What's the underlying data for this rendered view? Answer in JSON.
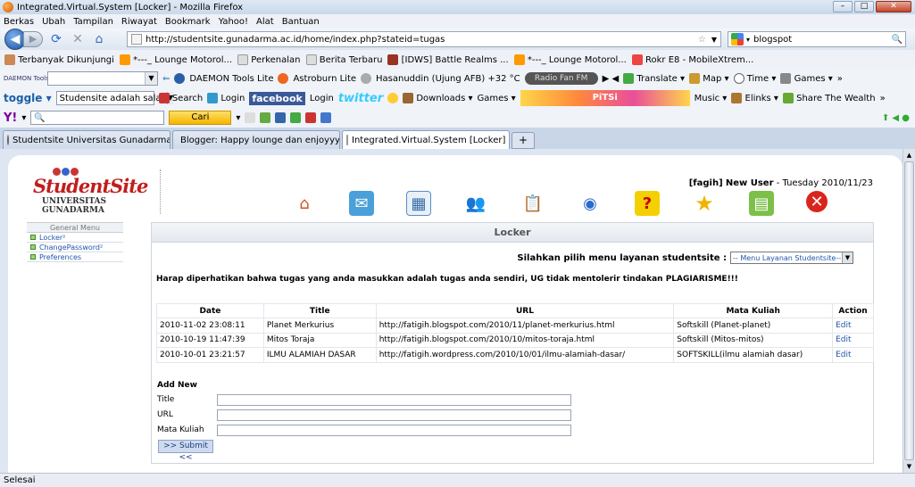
{
  "window": {
    "title": "Integrated.Virtual.System [Locker] - Mozilla Firefox"
  },
  "menubar": [
    "Berkas",
    "Ubah",
    "Tampilan",
    "Riwayat",
    "Bookmark",
    "Yahoo!",
    "Alat",
    "Bantuan"
  ],
  "nav": {
    "url": "http://studentsite.gunadarma.ac.id/home/index.php?stateid=tugas",
    "search_value": "blogspot"
  },
  "bookmarks": [
    "Terbanyak Dikunjungi",
    "*---_ Lounge Motorol...",
    "Perkenalan",
    "Berita Terbaru",
    "[IDWS] Battle Realms ...",
    "*---_ Lounge Motorol...",
    "Rokr E8 - MobileXtrem..."
  ],
  "toolbar1": {
    "daemon_label": "DAEMON Tools Lite",
    "astroburn": "Astroburn Lite",
    "weather": "Hasanuddin (Ujung AFB) +32 °C",
    "radio": "Radio Fan FM",
    "translate": "Translate",
    "map": "Map",
    "time": "Time",
    "games": "Games"
  },
  "toolbar2": {
    "toggle": "toggle",
    "combo_value": "Studensite adalah salah",
    "search": "Search",
    "login1": "Login",
    "facebook": "facebook",
    "login2": "Login",
    "twitter": "twitter",
    "downloads": "Downloads",
    "games": "Games",
    "pitsi": "PiTSi",
    "music": "Music",
    "elinks": "Elinks",
    "share": "Share The Wealth"
  },
  "toolbar3": {
    "yahoo": "Y!",
    "cari": "Cari"
  },
  "tabs": [
    {
      "label": "Studentsite Universitas Gunadarma ..."
    },
    {
      "label": "Blogger: Happy lounge dan enjoyyyy..."
    },
    {
      "label": "Integrated.Virtual.System [Locker]"
    }
  ],
  "site": {
    "logo_main": "StudentSite",
    "logo_sub": "UNIVERSITAS GUNADARMA",
    "user_name": "[fagih]",
    "user_status": "New User",
    "date": "- Tuesday 2010/11/23"
  },
  "sidebar": {
    "heading": "General Menu",
    "items": [
      {
        "label": "Locker²"
      },
      {
        "label": "ChangePassword²"
      },
      {
        "label": "Preferences"
      }
    ]
  },
  "locker": {
    "title": "Locker",
    "select_label": "Silahkan pilih menu layanan studentsite :",
    "select_value": "-- Menu Layanan Studentsite--",
    "notice": "Harap diperhatikan bahwa tugas yang anda masukkan adalah tugas anda sendiri, UG tidak mentolerir tindakan PLAGIARISME!!!",
    "columns": [
      "Date",
      "Title",
      "URL",
      "Mata Kuliah",
      "Action"
    ],
    "rows": [
      {
        "date": "2010-11-02 23:08:11",
        "title": "Planet Merkurius",
        "url": "http://fatigih.blogspot.com/2010/11/planet-merkurius.html",
        "matkul": "Softskill (Planet-planet)",
        "action": "Edit"
      },
      {
        "date": "2010-10-19 11:47:39",
        "title": "Mitos Toraja",
        "url": "http://fatigih.blogspot.com/2010/10/mitos-toraja.html",
        "matkul": "Softskill (Mitos-mitos)",
        "action": "Edit"
      },
      {
        "date": "2010-10-01 23:21:57",
        "title": "ILMU ALAMIAH DASAR",
        "url": "http://fatigih.wordpress.com/2010/10/01/ilmu-alamiah-dasar/",
        "matkul": "SOFTSKILL(ilmu alamiah dasar)",
        "action": "Edit"
      }
    ],
    "add_new": "Add New",
    "fields": {
      "title": "Title",
      "url": "URL",
      "matkul": "Mata Kuliah"
    },
    "submit": ">> Submit <<"
  },
  "status": "Selesai"
}
